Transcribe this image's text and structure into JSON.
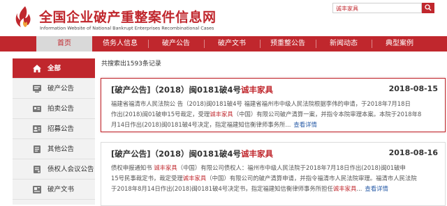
{
  "header": {
    "title_cn": "全国企业破产重整案件信息网",
    "title_en": "Information Website of National Bankrupt Enterprises Recombinational Cases",
    "logo_icon": "flame-logo-icon"
  },
  "search": {
    "value": "诚丰家具"
  },
  "nav": {
    "items": [
      {
        "label": "首页",
        "active": true
      },
      {
        "label": "债务人信息"
      },
      {
        "label": "破产公告"
      },
      {
        "label": "破产文书"
      },
      {
        "label": "预重整公告"
      },
      {
        "label": "新闻动态"
      },
      {
        "label": "典型案例"
      }
    ]
  },
  "sidebar": {
    "items": [
      {
        "label": "全部",
        "icon": "home-icon",
        "active": true
      },
      {
        "label": "破产公告",
        "icon": "gavel-icon"
      },
      {
        "label": "拍卖公告",
        "icon": "auction-icon"
      },
      {
        "label": "招募公告",
        "icon": "recruit-icon"
      },
      {
        "label": "其他公告",
        "icon": "notice-icon"
      },
      {
        "label": "债权人会议公告",
        "icon": "meeting-icon"
      },
      {
        "label": "破产文书",
        "icon": "document-icon"
      }
    ]
  },
  "results": {
    "count_text": "共搜索出1593条记录"
  },
  "cards": [
    {
      "title_prefix": "[破产公告]（2018）闽0181破4号",
      "title_highlight": "诚丰家具",
      "date": "2018-08-15",
      "line1": "福建省福清市人民法院公 告（2018)闽0181破4号 福建省福州市中级人民法院根据李伟的申请，于2018年7月18日",
      "line2_a": "作出(2018)闽01破申15号裁定，受理",
      "line2_hl": "诚丰家具",
      "line2_b": "（中国）有限公司破产清算一案，并指令本院审理本案。本院于2018年8",
      "line3": "月14日作出(2018)闽0181破4号决定，指定福建知信衡律师事务所...",
      "more": "查看详情"
    },
    {
      "title_prefix": "[破产公告]（2018）闽0181破4号",
      "title_highlight": "诚丰家具",
      "date": "2018-08-16",
      "line1_a": "债权申报通知书 ",
      "line1_hl": "诚丰家具",
      "line1_b": "（中国）有限公司债权人：福州市中级人民法院于2018年7月18日作出(2018)闽01破申",
      "line2_a": "15号民事裁定书，裁定受理",
      "line2_hl": "诚丰家具",
      "line2_b": "（中国）有限公司的破产清算申请，并指令福清市人民法院审理。福清市人民法院",
      "line3": "于2018年8月14日作出(2018)闽0181破4号决定书，指定福建知信衡律师事务所担任",
      "line3_hl": "诚丰家具",
      "line3_b": "...",
      "more": "查看详情"
    }
  ],
  "colors": {
    "brand": "#c0272d",
    "link": "#2b5ea8"
  }
}
